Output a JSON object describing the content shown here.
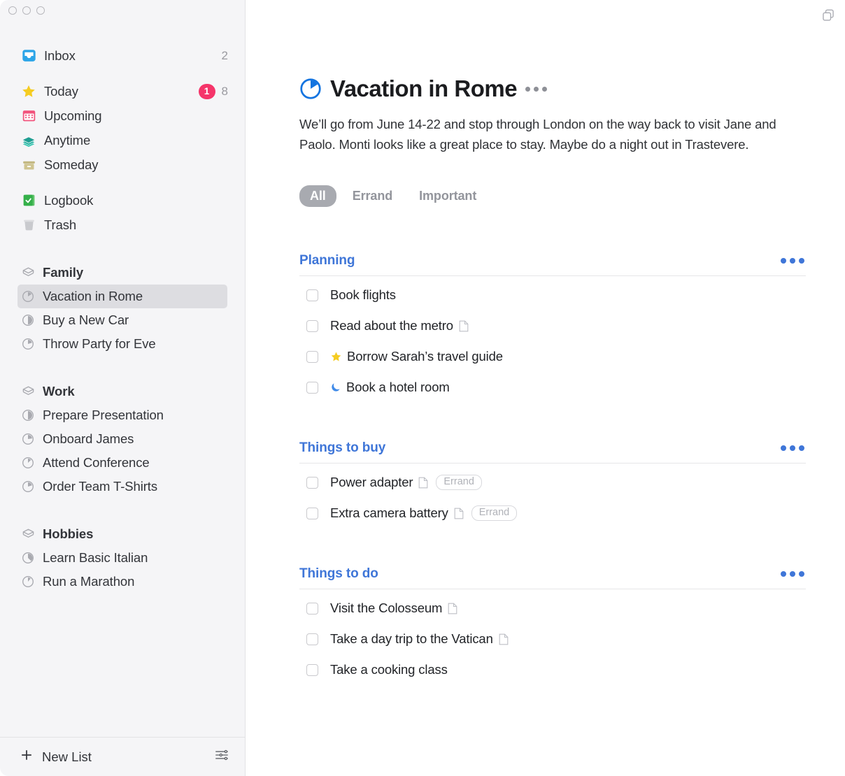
{
  "window": {
    "traffic_lights": [
      "close",
      "minimize",
      "zoom"
    ],
    "top_right_icon": "duplicate-window-icon",
    "sidebar_bg": "#f5f5f7",
    "accent_blue": "#3f76d8",
    "badge_red": "#f5356a"
  },
  "sidebar": {
    "smart_lists": [
      {
        "label": "Inbox",
        "icon": "inbox-icon",
        "count": "2"
      },
      {
        "label": "Today",
        "icon": "star-icon",
        "badge": "1",
        "count": "8"
      },
      {
        "label": "Upcoming",
        "icon": "calendar-icon"
      },
      {
        "label": "Anytime",
        "icon": "layers-icon"
      },
      {
        "label": "Someday",
        "icon": "box-icon"
      },
      {
        "label": "Logbook",
        "icon": "logbook-icon"
      },
      {
        "label": "Trash",
        "icon": "trash-icon"
      }
    ],
    "areas": [
      {
        "label": "Family",
        "icon": "area-icon",
        "projects": [
          {
            "label": "Vacation in Rome",
            "icon": "project-progress-icon",
            "progress": 0.22,
            "selected": true
          },
          {
            "label": "Buy a New Car",
            "icon": "project-progress-icon",
            "progress": 0.5,
            "selected": false
          },
          {
            "label": "Throw Party for Eve",
            "icon": "project-progress-icon",
            "progress": 0.3,
            "selected": false
          }
        ]
      },
      {
        "label": "Work",
        "icon": "area-icon",
        "projects": [
          {
            "label": "Prepare Presentation",
            "icon": "project-progress-icon",
            "progress": 0.5,
            "selected": false
          },
          {
            "label": "Onboard James",
            "icon": "project-progress-icon",
            "progress": 0.33,
            "selected": false
          },
          {
            "label": "Attend Conference",
            "icon": "project-progress-icon",
            "progress": 0.18,
            "selected": false
          },
          {
            "label": "Order Team T-Shirts",
            "icon": "project-progress-icon",
            "progress": 0.3,
            "selected": false
          }
        ]
      },
      {
        "label": "Hobbies",
        "icon": "area-icon",
        "projects": [
          {
            "label": "Learn Basic Italian",
            "icon": "project-progress-icon",
            "progress": 0.42,
            "selected": false
          },
          {
            "label": "Run a Marathon",
            "icon": "project-progress-icon",
            "progress": 0.15,
            "selected": false
          }
        ]
      }
    ],
    "footer": {
      "new_list_label": "New List",
      "plus_icon": "plus-icon",
      "settings_icon": "sliders-icon"
    }
  },
  "main": {
    "project_icon": "project-progress-icon",
    "title": "Vacation in Rome",
    "title_menu_icon": "more-options-icon",
    "notes": "We’ll go from June 14-22 and stop through London on the way back to visit Jane and Paolo. Monti looks like a great place to stay. Maybe do a night out in Trastevere.",
    "filters": [
      {
        "label": "All",
        "active": true
      },
      {
        "label": "Errand",
        "active": false
      },
      {
        "label": "Important",
        "active": false
      }
    ],
    "sections": [
      {
        "title": "Planning",
        "menu_icon": "more-options-icon",
        "tasks": [
          {
            "title": "Book flights",
            "marker": null,
            "has_note": false,
            "tag": null
          },
          {
            "title": "Read about the metro",
            "marker": null,
            "has_note": true,
            "tag": null
          },
          {
            "title": "Borrow Sarah’s travel guide",
            "marker": "star-icon",
            "has_note": false,
            "tag": null
          },
          {
            "title": "Book a hotel room",
            "marker": "moon-icon",
            "has_note": false,
            "tag": null
          }
        ]
      },
      {
        "title": "Things to buy",
        "menu_icon": "more-options-icon",
        "tasks": [
          {
            "title": "Power adapter",
            "marker": null,
            "has_note": true,
            "tag": "Errand"
          },
          {
            "title": "Extra camera battery",
            "marker": null,
            "has_note": true,
            "tag": "Errand"
          }
        ]
      },
      {
        "title": "Things to do",
        "menu_icon": "more-options-icon",
        "tasks": [
          {
            "title": "Visit the Colosseum",
            "marker": null,
            "has_note": true,
            "tag": null
          },
          {
            "title": "Take a day trip to the Vatican",
            "marker": null,
            "has_note": true,
            "tag": null
          },
          {
            "title": "Take a cooking class",
            "marker": null,
            "has_note": false,
            "tag": null
          }
        ]
      }
    ]
  }
}
